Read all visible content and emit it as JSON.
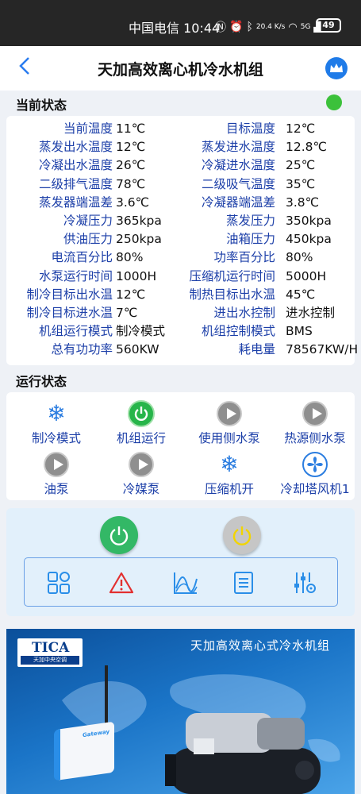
{
  "statusbar": {
    "carrier_time": "中国电信 10:44",
    "speed": "20.4 K/s",
    "network": "5G",
    "battery": "49"
  },
  "appbar": {
    "back_glyph": "‹",
    "title": "天加高效离心机冷水机组"
  },
  "current_status": {
    "title": "当前状态",
    "indicator_color": "#3cc13b",
    "rows": [
      {
        "l1": "当前温度",
        "v1": "11℃",
        "l2": "目标温度",
        "v2": "12℃"
      },
      {
        "l1": "蒸发出水温度",
        "v1": "12℃",
        "l2": "蒸发进水温度",
        "v2": "12.8℃"
      },
      {
        "l1": "冷凝出水温度",
        "v1": "26℃",
        "l2": "冷凝进水温度",
        "v2": "25℃"
      },
      {
        "l1": "二级排气温度",
        "v1": "78℃",
        "l2": "二级吸气温度",
        "v2": "35℃"
      },
      {
        "l1": "蒸发器端温差",
        "v1": "3.6℃",
        "l2": "冷凝器端温差",
        "v2": "3.8℃"
      },
      {
        "l1": "冷凝压力",
        "v1": "365kpa",
        "l2": "蒸发压力",
        "v2": "350kpa"
      },
      {
        "l1": "供油压力",
        "v1": "250kpa",
        "l2": "油箱压力",
        "v2": "450kpa"
      },
      {
        "l1": "电流百分比",
        "v1": "80%",
        "l2": "功率百分比",
        "v2": "80%"
      },
      {
        "l1": "水泵运行时间",
        "v1": "1000H",
        "l2": "压缩机运行时间",
        "v2": "5000H"
      },
      {
        "l1": "制冷目标出水温",
        "v1": "12℃",
        "l2": "制热目标出水温",
        "v2": "45℃"
      },
      {
        "l1": "制冷目标进水温",
        "v1": "7℃",
        "l2": "进出水控制",
        "v2": "进水控制"
      },
      {
        "l1": "机组运行模式",
        "v1": "制冷模式",
        "l2": "机组控制模式",
        "v2": "BMS"
      },
      {
        "l1": "总有功功率",
        "v1": "560KW",
        "l2": "耗电量",
        "v2": "78567KW/H"
      }
    ]
  },
  "run_status": {
    "title": "运行状态",
    "items": [
      {
        "label": "制冷模式",
        "icon": "snowflake-icon"
      },
      {
        "label": "机组运行",
        "icon": "power-on-icon"
      },
      {
        "label": "使用侧水泵",
        "icon": "play-icon"
      },
      {
        "label": "热源侧水泵",
        "icon": "play-icon"
      },
      {
        "label": "油泵",
        "icon": "play-icon"
      },
      {
        "label": "冷媒泵",
        "icon": "play-icon"
      },
      {
        "label": "压缩机开",
        "icon": "snowflake-icon"
      },
      {
        "label": "冷却塔风机1",
        "icon": "fan-icon"
      }
    ]
  },
  "controls": {
    "power_on_color": "#33b866",
    "power_off_color": "#c6c6c6",
    "tools": [
      "grid-icon",
      "alarm-icon",
      "chart-icon",
      "list-icon",
      "settings-sliders-icon"
    ]
  },
  "banner": {
    "logo_text": "TICA",
    "logo_sub": "天加中央空调",
    "headline": "天加高效离心式冷水机组",
    "gateway_label": "Gateway"
  }
}
